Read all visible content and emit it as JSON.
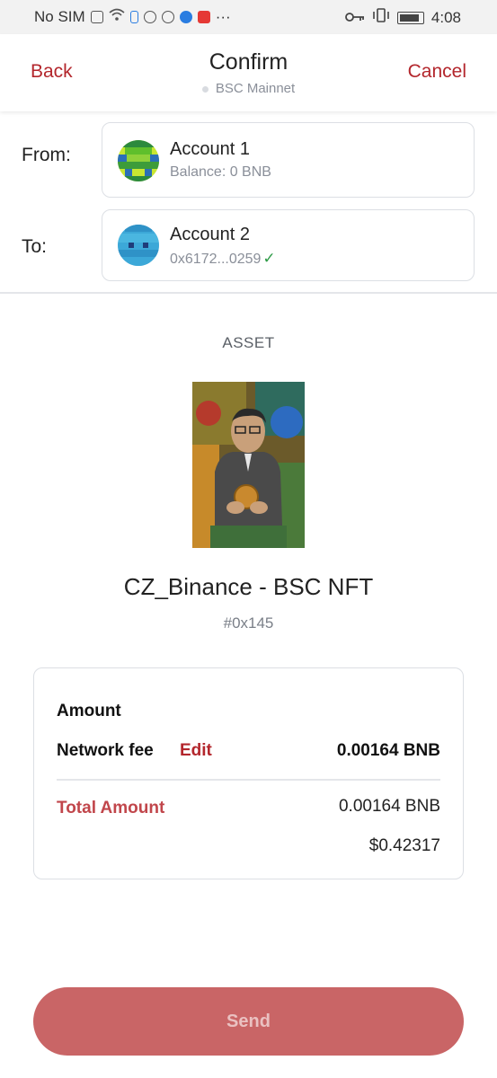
{
  "status_bar": {
    "carrier": "No SIM",
    "time": "4:08",
    "icons": [
      "sim-alert-icon",
      "wifi-icon",
      "battery-saver-icon",
      "settings-icon",
      "chrome-icon",
      "browser-icon",
      "app-icon",
      "more-icon",
      "key-icon",
      "vibrate-icon",
      "battery-icon"
    ]
  },
  "header": {
    "back_label": "Back",
    "title": "Confirm",
    "network": "BSC Mainnet",
    "cancel_label": "Cancel"
  },
  "from": {
    "label": "From:",
    "account_name": "Account 1",
    "balance": "Balance: 0 BNB"
  },
  "to": {
    "label": "To:",
    "account_name": "Account 2",
    "address": "0x6172...0259",
    "verified_glyph": "✓"
  },
  "asset": {
    "label": "ASSET",
    "name": "CZ_Binance - BSC NFT",
    "token_id": "#0x145"
  },
  "summary": {
    "amount_label": "Amount",
    "network_fee_label": "Network fee",
    "edit_label": "Edit",
    "network_fee_value": "0.00164 BNB",
    "total_label": "Total Amount",
    "total_value": "0.00164 BNB",
    "total_usd": "$0.42317"
  },
  "send_label": "Send",
  "colors": {
    "accent": "#b3262c",
    "send_button": "#c96566",
    "verified": "#2e9b47"
  }
}
